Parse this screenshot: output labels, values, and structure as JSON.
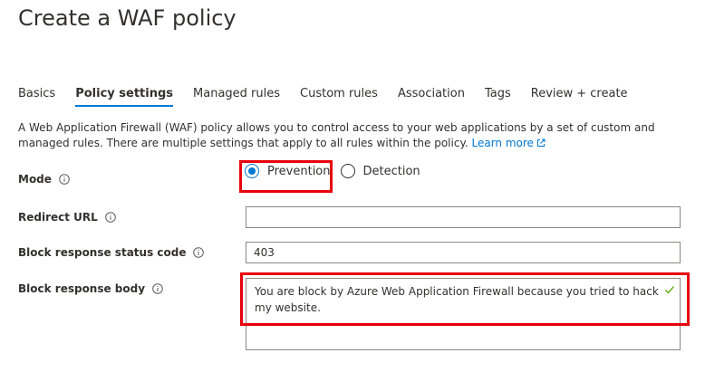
{
  "page": {
    "title": "Create a WAF policy"
  },
  "tabs": [
    {
      "label": "Basics",
      "active": false
    },
    {
      "label": "Policy settings",
      "active": true
    },
    {
      "label": "Managed rules",
      "active": false
    },
    {
      "label": "Custom rules",
      "active": false
    },
    {
      "label": "Association",
      "active": false
    },
    {
      "label": "Tags",
      "active": false
    },
    {
      "label": "Review + create",
      "active": false
    }
  ],
  "description": {
    "text": "A Web Application Firewall (WAF) policy allows you to control access to your web applications by a set of custom and managed rules. There are multiple settings that apply to all rules within the policy.",
    "link_label": "Learn more",
    "link_icon": "external-link-icon"
  },
  "form": {
    "mode": {
      "label": "Mode",
      "options": [
        "Prevention",
        "Detection"
      ],
      "selected": "Prevention"
    },
    "redirect_url": {
      "label": "Redirect URL",
      "value": ""
    },
    "block_status_code": {
      "label": "Block response status code",
      "value": "403"
    },
    "block_response_body": {
      "label": "Block response body",
      "value": "You are block by Azure Web Application Firewall because you tried to hack my website.",
      "valid": true
    }
  },
  "colors": {
    "accent": "#0078d4",
    "highlight": "#e8000b",
    "valid": "#57a300"
  }
}
